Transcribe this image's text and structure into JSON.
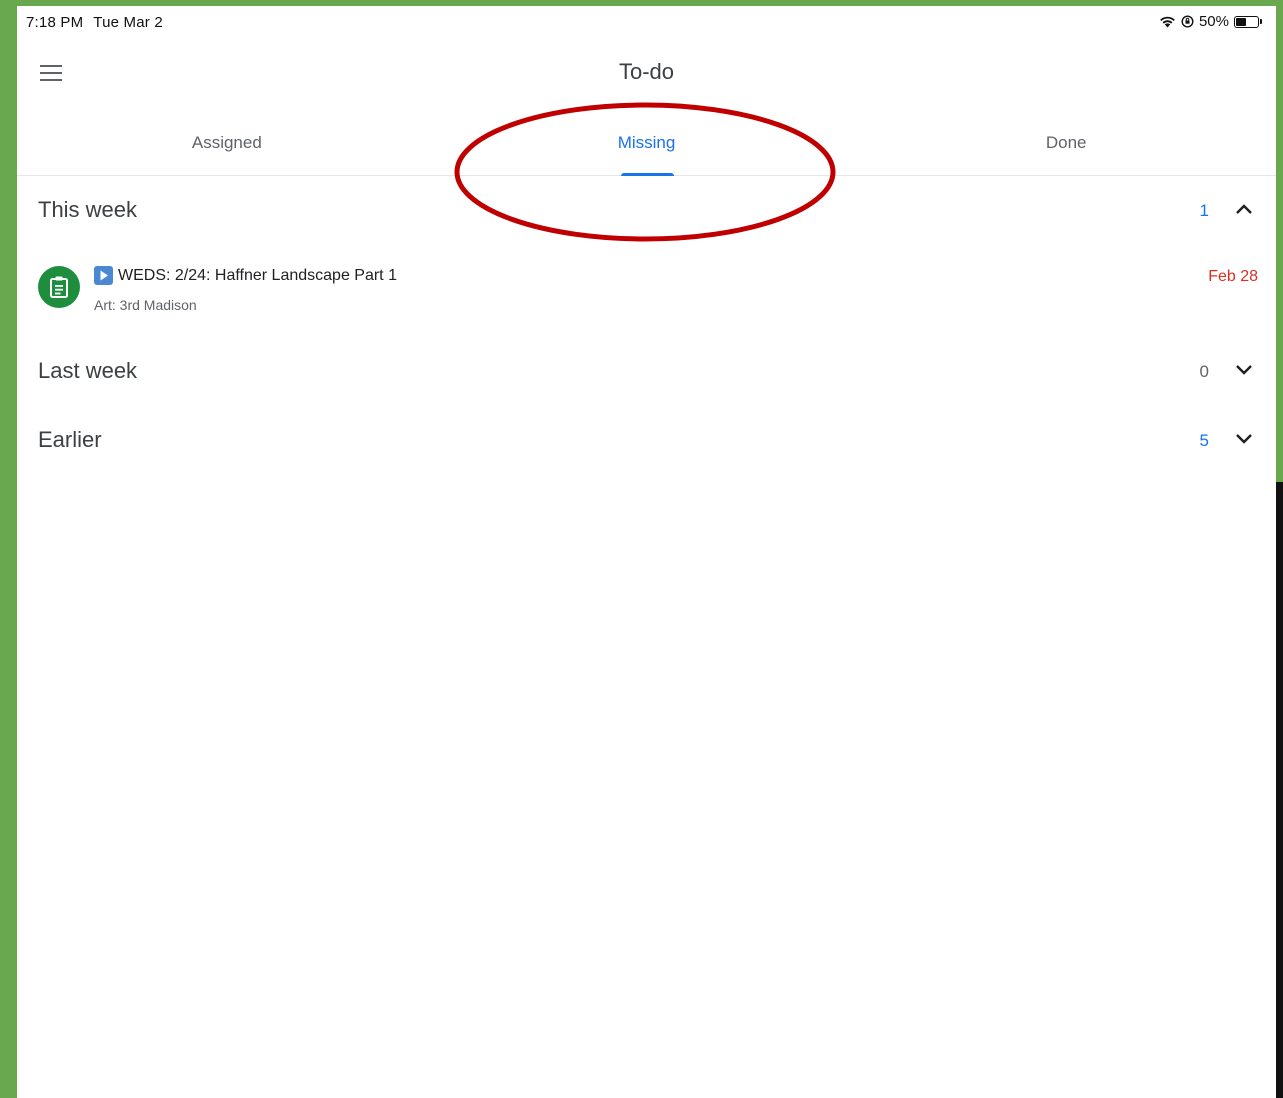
{
  "status_bar": {
    "time": "7:18 PM",
    "date": "Tue Mar 2",
    "battery": "50%",
    "battery_level": 0.5
  },
  "app_bar": {
    "title": "To-do",
    "menu_icon": "hamburger-menu-icon"
  },
  "tabs": [
    {
      "label": "Assigned",
      "active": false
    },
    {
      "label": "Missing",
      "active": true
    },
    {
      "label": "Done",
      "active": false
    }
  ],
  "annotation": {
    "shape": "oval",
    "color": "#c00000"
  },
  "sections": [
    {
      "title": "This week",
      "count": "1",
      "expanded": true
    },
    {
      "title": "Last week",
      "count": "0",
      "expanded": false
    },
    {
      "title": "Earlier",
      "count": "5",
      "expanded": false
    }
  ],
  "assignment": {
    "icon": "assignment-icon",
    "title": "WEDS: 2/24: Haffner Landscape Part 1",
    "class": "Art: 3rd Madison",
    "due": "Feb 28"
  },
  "colors": {
    "accent": "#1a73e8",
    "overdue": "#d93025",
    "assignment_icon_bg": "#1e8e3e",
    "frame": "#6aa84f"
  }
}
